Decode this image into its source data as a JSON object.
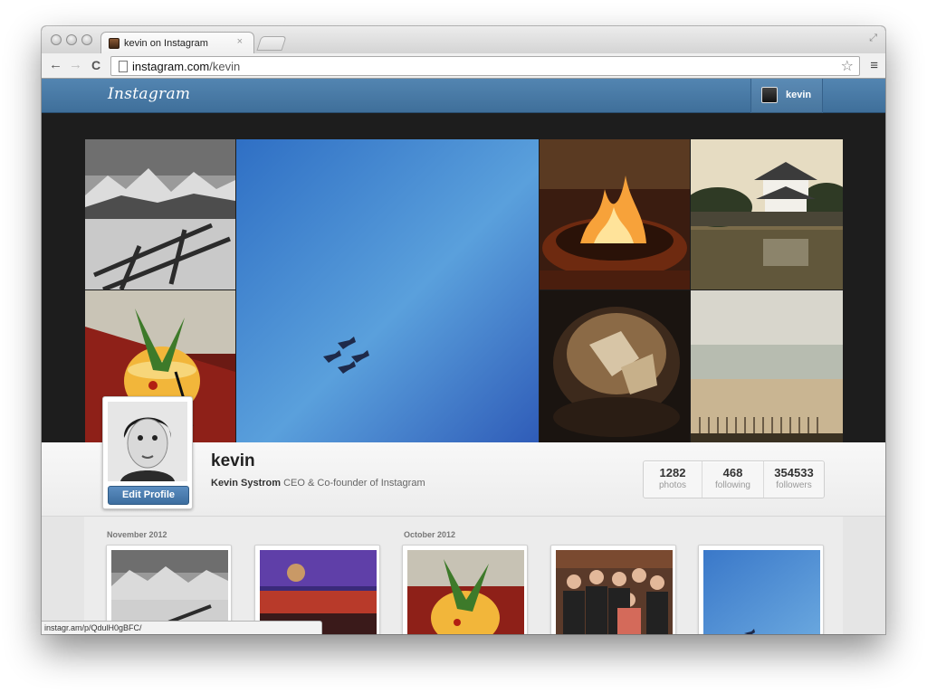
{
  "browser": {
    "tab_title": "kevin on Instagram",
    "tab_close": "×",
    "url_host": "instagram.com",
    "url_path": "/kevin",
    "back_glyph": "←",
    "forward_glyph": "→",
    "reload_glyph": "C",
    "star_glyph": "☆",
    "menu_glyph": "≡",
    "fullscreen_glyph": "⤢"
  },
  "header": {
    "logo": "Instagram",
    "username": "kevin"
  },
  "profile": {
    "name": "kevin",
    "full_name": "Kevin Systrom",
    "bio": "CEO & Co-founder of Instagram",
    "edit_button": "Edit Profile",
    "stats": [
      {
        "value": "1282",
        "label": "photos"
      },
      {
        "value": "468",
        "label": "following"
      },
      {
        "value": "354533",
        "label": "followers"
      }
    ]
  },
  "feed": {
    "months": [
      "November 2012",
      "October 2012"
    ]
  },
  "status_bar": "instagr.am/p/QdulH0gBFC/",
  "icons": {
    "page": "page-icon",
    "star": "star-icon",
    "menu": "hamburger-menu-icon"
  }
}
